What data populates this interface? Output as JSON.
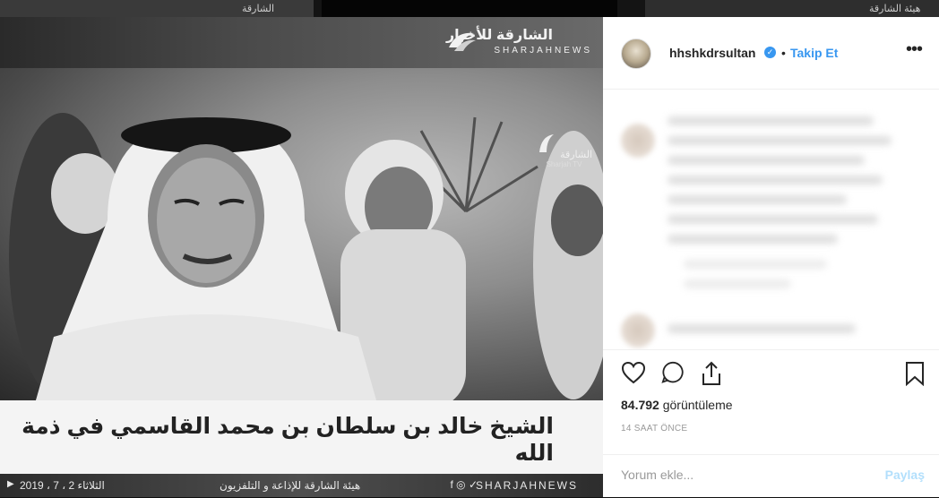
{
  "top_strip": {
    "thumb1_text": "الشارقة",
    "thumb3_text": "هيئة الشارقة"
  },
  "media": {
    "brand_ar": "الشارقة للأخبار",
    "brand_en": "SHARJAHNEWS",
    "tv_logo_ar": "الشارقة",
    "tv_logo_en": "Sharjah TV",
    "caption": "الشيخ خالد بن سلطان بن محمد القاسمي في ذمة الله",
    "ticker_date": "2019 ، 7 ، 2  الثلاثاء",
    "ticker_mid": "هيئة الشارقة للإذاعة و التلفزيون",
    "ticker_brand": "SHARJAHNEWS",
    "ticker_social": "f ◎ ✓"
  },
  "side": {
    "username": "hhshkdrsultan",
    "separator": "•",
    "follow_label": "Takip Et",
    "more_label": "•••",
    "views_count": "84.792",
    "views_label": "görüntüleme",
    "time_ago": "14 SAAT ÖNCE",
    "comment_placeholder": "Yorum ekle...",
    "share_label": "Paylaş"
  },
  "colors": {
    "accent": "#3897f0",
    "share_disabled": "#b2dffc",
    "text": "#262626",
    "muted": "#999999"
  }
}
